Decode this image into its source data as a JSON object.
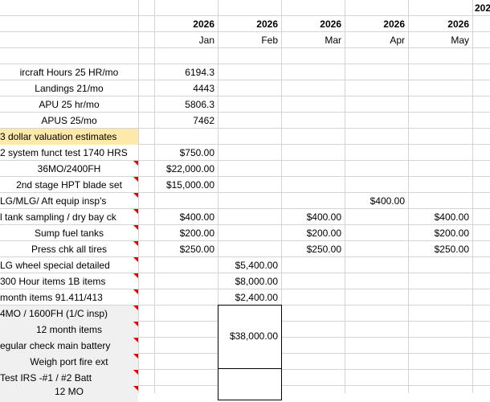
{
  "header": {
    "top_right_year": "202",
    "years": [
      "2026",
      "2026",
      "2026",
      "2026",
      "2026"
    ],
    "months": [
      "Jan",
      "Feb",
      "Mar",
      "Apr",
      "May"
    ]
  },
  "rows": [
    "ircraft Hours 25 HR/mo",
    "Landings 21/mo",
    "APU 25 hr/mo",
    "APUS 25/mo",
    "3 dollar valuation estimates",
    "2 system funct test 1740 HRS",
    "36MO/2400FH",
    "2nd stage HPT blade set",
    "LG/MLG/ Aft equip insp's",
    "l tank sampling / dry bay ck",
    "Sump fuel tanks",
    "Press chk all tires",
    "LG wheel special detailed",
    "300 Hour items 1B items",
    " month items 91.411/413",
    "4MO / 1600FH (1/C insp)",
    "12 month items",
    "egular check main battery",
    "Weigh port fire ext",
    "Test IRS -#1 / #2 Batt",
    "12 MO"
  ],
  "values": {
    "jan": [
      "6194.3",
      "4443",
      "5806.3",
      "7462",
      "",
      "$750.00",
      "$22,000.00",
      "$15,000.00",
      "",
      "$400.00",
      "$200.00",
      "$250.00"
    ],
    "feb": [
      "$5,400.00",
      "$8,000.00",
      "$2,400.00",
      "$38,000.00"
    ],
    "mar": [
      "$400.00",
      "$200.00",
      "$250.00"
    ],
    "apr": [
      "$400.00"
    ],
    "may": [
      "$400.00",
      "$200.00",
      "$250.00"
    ]
  }
}
